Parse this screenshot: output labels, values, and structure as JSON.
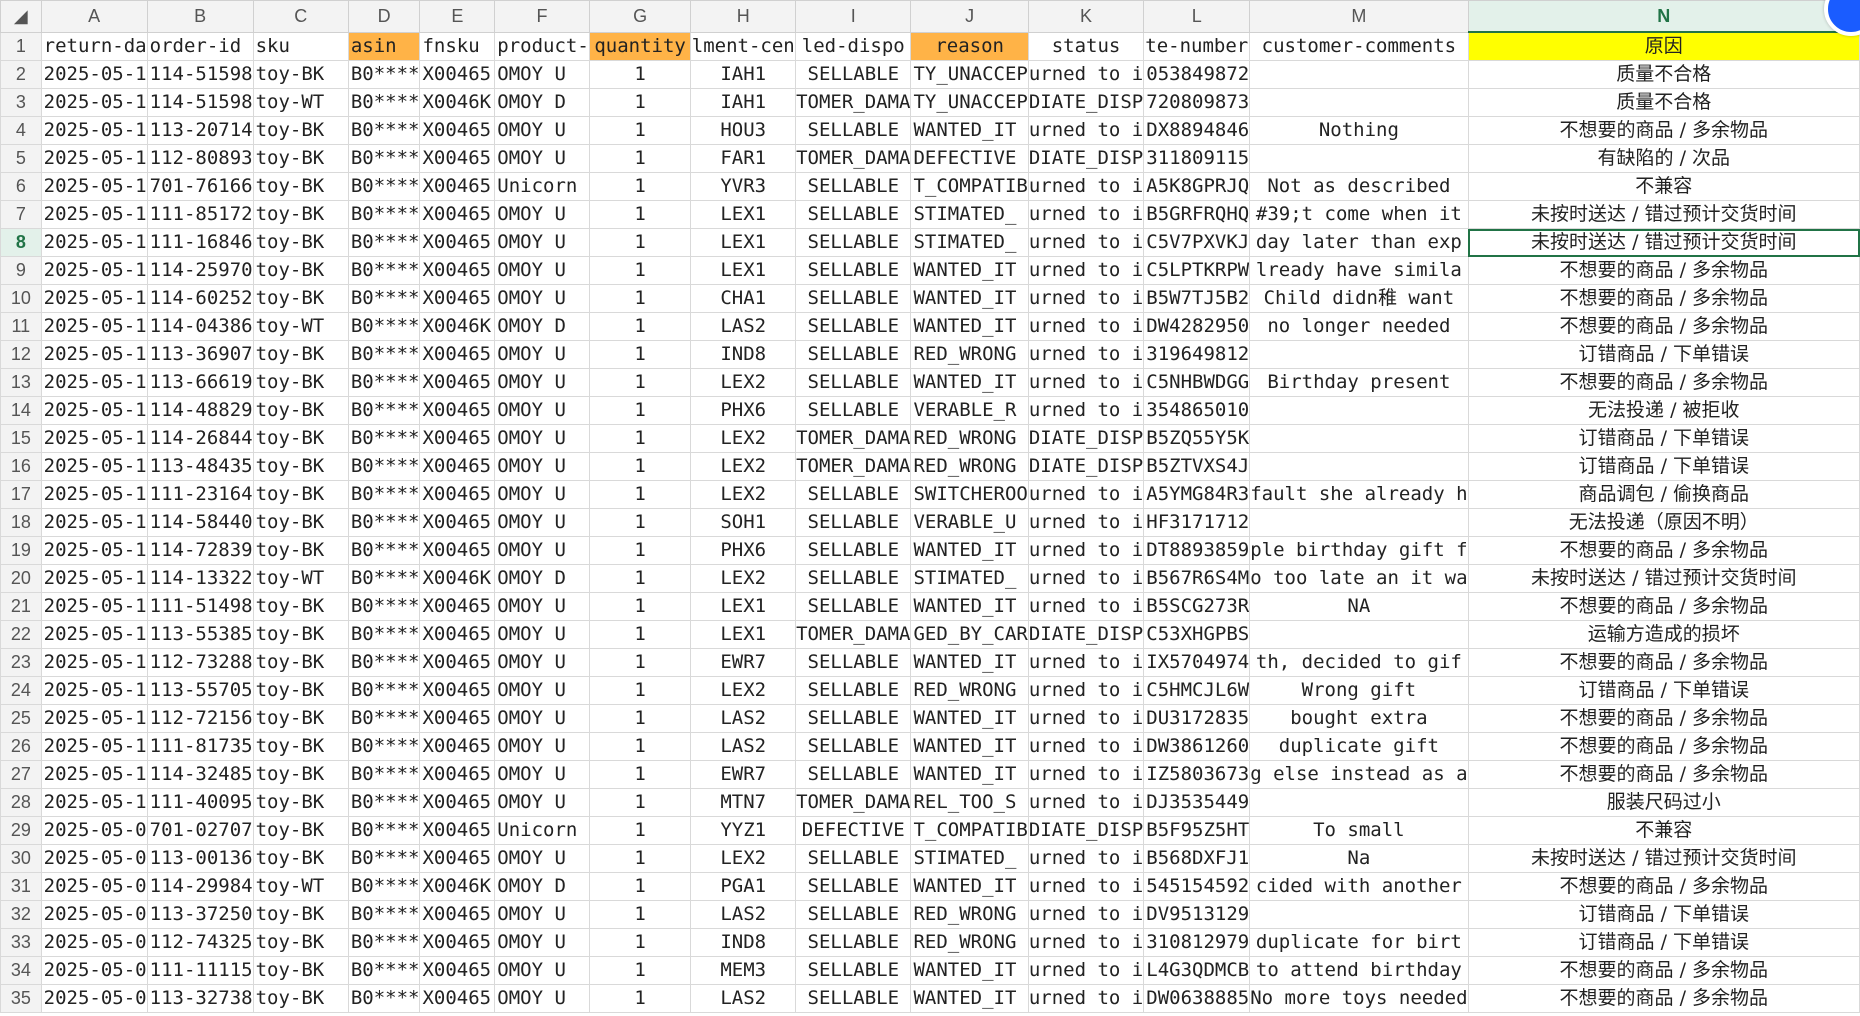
{
  "columns": [
    "A",
    "B",
    "C",
    "D",
    "E",
    "F",
    "G",
    "H",
    "I",
    "J",
    "K",
    "L",
    "M",
    "N"
  ],
  "selected_cell": "N8",
  "header_row": [
    "return-da",
    "order-id",
    "sku",
    "asin",
    "fnsku",
    "product-",
    "quantity",
    "lment-cen",
    "led-dispo",
    "reason",
    "status",
    "te-number",
    "customer-comments",
    "原因"
  ],
  "header_colors": {
    "asin": "#ffb347",
    "quantity": "#ffb347",
    "reason": "#ffb347",
    "原因": "#ffff00"
  },
  "rows": [
    [
      "2025-05-1",
      "114-51598",
      "toy-BK",
      "B0****",
      "X00465",
      "OMOY  U",
      "1",
      "IAH1",
      "SELLABLE",
      "TY_UNACCEP",
      "urned to i",
      "053849872",
      "",
      "质量不合格"
    ],
    [
      "2025-05-1",
      "114-51598",
      "toy-WT",
      "B0****",
      "X0046K",
      "OMOY  D",
      "1",
      "IAH1",
      "TOMER_DAMA",
      "TY_UNACCEP",
      "DIATE_DISP",
      "720809873",
      "",
      "质量不合格"
    ],
    [
      "2025-05-1",
      "113-20714",
      "toy-BK",
      "B0****",
      "X00465",
      "OMOY  U",
      "1",
      "HOU3",
      "SELLABLE",
      "WANTED_IT",
      "urned to i",
      "DX8894846",
      "Nothing",
      "不想要的商品 / 多余物品"
    ],
    [
      "2025-05-1",
      "112-80893",
      "toy-BK",
      "B0****",
      "X00465",
      "OMOY  U",
      "1",
      "FAR1",
      "TOMER_DAMA",
      "DEFECTIVE",
      "DIATE_DISP",
      "311809115",
      "",
      "有缺陷的 / 次品"
    ],
    [
      "2025-05-1",
      "701-76166",
      "toy-BK",
      "B0****",
      "X00465",
      "Unicorn",
      "1",
      "YVR3",
      "SELLABLE",
      "T_COMPATIB",
      "urned to i",
      "A5K8GPRJQ",
      "Not as described",
      "不兼容"
    ],
    [
      "2025-05-1",
      "111-85172",
      "toy-BK",
      "B0****",
      "X00465",
      "OMOY  U",
      "1",
      "LEX1",
      "SELLABLE",
      "STIMATED_",
      "urned to i",
      "B5GRFRQHQ",
      "#39;t come when it",
      "未按时送达 / 错过预计交货时间"
    ],
    [
      "2025-05-1",
      "111-16846",
      "toy-BK",
      "B0****",
      "X00465",
      "OMOY  U",
      "1",
      "LEX1",
      "SELLABLE",
      "STIMATED_",
      "urned to i",
      "C5V7PXVKJ",
      "day later than exp",
      "未按时送达 / 错过预计交货时间"
    ],
    [
      "2025-05-1",
      "114-25970",
      "toy-BK",
      "B0****",
      "X00465",
      "OMOY  U",
      "1",
      "LEX1",
      "SELLABLE",
      "WANTED_IT",
      "urned to i",
      "C5LPTKRPW",
      "lready have simila",
      "不想要的商品 / 多余物品"
    ],
    [
      "2025-05-1",
      "114-60252",
      "toy-BK",
      "B0****",
      "X00465",
      "OMOY  U",
      "1",
      "CHA1",
      "SELLABLE",
      "WANTED_IT",
      "urned to i",
      "B5W7TJ5B2",
      "Child didn稚 want",
      "不想要的商品 / 多余物品"
    ],
    [
      "2025-05-1",
      "114-04386",
      "toy-WT",
      "B0****",
      "X0046K",
      "OMOY  D",
      "1",
      "LAS2",
      "SELLABLE",
      "WANTED_IT",
      "urned to i",
      "DW4282950",
      "no longer needed",
      "不想要的商品 / 多余物品"
    ],
    [
      "2025-05-1",
      "113-36907",
      "toy-BK",
      "B0****",
      "X00465",
      "OMOY  U",
      "1",
      "IND8",
      "SELLABLE",
      "RED_WRONG",
      "urned to i",
      "319649812",
      "",
      "订错商品 / 下单错误"
    ],
    [
      "2025-05-1",
      "113-66619",
      "toy-BK",
      "B0****",
      "X00465",
      "OMOY  U",
      "1",
      "LEX2",
      "SELLABLE",
      "WANTED_IT",
      "urned to i",
      "C5NHBWDGG",
      "Birthday present",
      "不想要的商品 / 多余物品"
    ],
    [
      "2025-05-1",
      "114-48829",
      "toy-BK",
      "B0****",
      "X00465",
      "OMOY  U",
      "1",
      "PHX6",
      "SELLABLE",
      "VERABLE_R",
      "urned to i",
      "354865010",
      "",
      "无法投递 / 被拒收"
    ],
    [
      "2025-05-1",
      "114-26844",
      "toy-BK",
      "B0****",
      "X00465",
      "OMOY  U",
      "1",
      "LEX2",
      "TOMER_DAMA",
      "RED_WRONG",
      "DIATE_DISP",
      "B5ZQ55Y5K",
      "",
      "订错商品 / 下单错误"
    ],
    [
      "2025-05-1",
      "113-48435",
      "toy-BK",
      "B0****",
      "X00465",
      "OMOY  U",
      "1",
      "LEX2",
      "TOMER_DAMA",
      "RED_WRONG",
      "DIATE_DISP",
      "B5ZTVXS4J",
      "",
      "订错商品 / 下单错误"
    ],
    [
      "2025-05-1",
      "111-23164",
      "toy-BK",
      "B0****",
      "X00465",
      "OMOY  U",
      "1",
      "LEX2",
      "SELLABLE",
      "SWITCHEROO",
      "urned to i",
      "A5YMG84R3",
      "fault she already h",
      "商品调包 / 偷换商品"
    ],
    [
      "2025-05-1",
      "114-58440",
      "toy-BK",
      "B0****",
      "X00465",
      "OMOY  U",
      "1",
      "SOH1",
      "SELLABLE",
      "VERABLE_U",
      "urned to i",
      "HF3171712",
      "",
      "无法投递（原因不明）"
    ],
    [
      "2025-05-1",
      "114-72839",
      "toy-BK",
      "B0****",
      "X00465",
      "OMOY  U",
      "1",
      "PHX6",
      "SELLABLE",
      "WANTED_IT",
      "urned to i",
      "DT8893859",
      "ple birthday gift f",
      "不想要的商品 / 多余物品"
    ],
    [
      "2025-05-1",
      "114-13322",
      "toy-WT",
      "B0****",
      "X0046K",
      "OMOY  D",
      "1",
      "LEX2",
      "SELLABLE",
      "STIMATED_",
      "urned to i",
      "B567R6S4M",
      "o too late an it wa",
      "未按时送达 / 错过预计交货时间"
    ],
    [
      "2025-05-1",
      "111-51498",
      "toy-BK",
      "B0****",
      "X00465",
      "OMOY  U",
      "1",
      "LEX1",
      "SELLABLE",
      "WANTED_IT",
      "urned to i",
      "B5SCG273R",
      "NA",
      "不想要的商品 / 多余物品"
    ],
    [
      "2025-05-1",
      "113-55385",
      "toy-BK",
      "B0****",
      "X00465",
      "OMOY  U",
      "1",
      "LEX1",
      "TOMER_DAMA",
      "GED_BY_CAR",
      "DIATE_DISP",
      "C53XHGPBS",
      "",
      "运输方造成的损坏"
    ],
    [
      "2025-05-1",
      "112-73288",
      "toy-BK",
      "B0****",
      "X00465",
      "OMOY  U",
      "1",
      "EWR7",
      "SELLABLE",
      "WANTED_IT",
      "urned to i",
      "IX5704974",
      "th, decided to gif",
      "不想要的商品 / 多余物品"
    ],
    [
      "2025-05-1",
      "113-55705",
      "toy-BK",
      "B0****",
      "X00465",
      "OMOY  U",
      "1",
      "LEX2",
      "SELLABLE",
      "RED_WRONG",
      "urned to i",
      "C5HMCJL6W",
      "Wrong gift",
      "订错商品 / 下单错误"
    ],
    [
      "2025-05-1",
      "112-72156",
      "toy-BK",
      "B0****",
      "X00465",
      "OMOY  U",
      "1",
      "LAS2",
      "SELLABLE",
      "WANTED_IT",
      "urned to i",
      "DU3172835",
      "bought extra",
      "不想要的商品 / 多余物品"
    ],
    [
      "2025-05-1",
      "111-81735",
      "toy-BK",
      "B0****",
      "X00465",
      "OMOY  U",
      "1",
      "LAS2",
      "SELLABLE",
      "WANTED_IT",
      "urned to i",
      "DW3861260",
      "duplicate gift",
      "不想要的商品 / 多余物品"
    ],
    [
      "2025-05-1",
      "114-32485",
      "toy-BK",
      "B0****",
      "X00465",
      "OMOY  U",
      "1",
      "EWR7",
      "SELLABLE",
      "WANTED_IT",
      "urned to i",
      "IZ5803673",
      "g else instead as a",
      "不想要的商品 / 多余物品"
    ],
    [
      "2025-05-1",
      "111-40095",
      "toy-BK",
      "B0****",
      "X00465",
      "OMOY  U",
      "1",
      "MTN7",
      "TOMER_DAMA",
      "REL_TOO_S",
      "urned to i",
      "DJ3535449",
      "",
      "服装尺码过小"
    ],
    [
      "2025-05-0",
      "701-02707",
      "toy-BK",
      "B0****",
      "X00465",
      "Unicorn",
      "1",
      "YYZ1",
      "DEFECTIVE",
      "T_COMPATIB",
      "DIATE_DISP",
      "B5F95Z5HT",
      "To small",
      "不兼容"
    ],
    [
      "2025-05-0",
      "113-00136",
      "toy-BK",
      "B0****",
      "X00465",
      "OMOY  U",
      "1",
      "LEX2",
      "SELLABLE",
      "STIMATED_",
      "urned to i",
      "B568DXFJ1",
      "Na",
      "未按时送达 / 错过预计交货时间"
    ],
    [
      "2025-05-0",
      "114-29984",
      "toy-WT",
      "B0****",
      "X0046K",
      "OMOY  D",
      "1",
      "PGA1",
      "SELLABLE",
      "WANTED_IT",
      "urned to i",
      "545154592",
      "cided with another",
      "不想要的商品 / 多余物品"
    ],
    [
      "2025-05-0",
      "113-37250",
      "toy-BK",
      "B0****",
      "X00465",
      "OMOY  U",
      "1",
      "LAS2",
      "SELLABLE",
      "RED_WRONG",
      "urned to i",
      "DV9513129",
      "",
      "订错商品 / 下单错误"
    ],
    [
      "2025-05-0",
      "112-74325",
      "toy-BK",
      "B0****",
      "X00465",
      "OMOY  U",
      "1",
      "IND8",
      "SELLABLE",
      "RED_WRONG",
      "urned to i",
      "310812979",
      "duplicate for birt",
      "订错商品 / 下单错误"
    ],
    [
      "2025-05-0",
      "111-11115",
      "toy-BK",
      "B0****",
      "X00465",
      "OMOY  U",
      "1",
      "MEM3",
      "SELLABLE",
      "WANTED_IT",
      "urned to i",
      "L4G3QDMCB",
      "to attend birthday",
      "不想要的商品 / 多余物品"
    ],
    [
      "2025-05-0",
      "113-32738",
      "toy-BK",
      "B0****",
      "X00465",
      "OMOY  U",
      "1",
      "LAS2",
      "SELLABLE",
      "WANTED_IT",
      "urned to i",
      "DW0638885",
      "No more toys needed",
      "不想要的商品 / 多余物品"
    ]
  ]
}
